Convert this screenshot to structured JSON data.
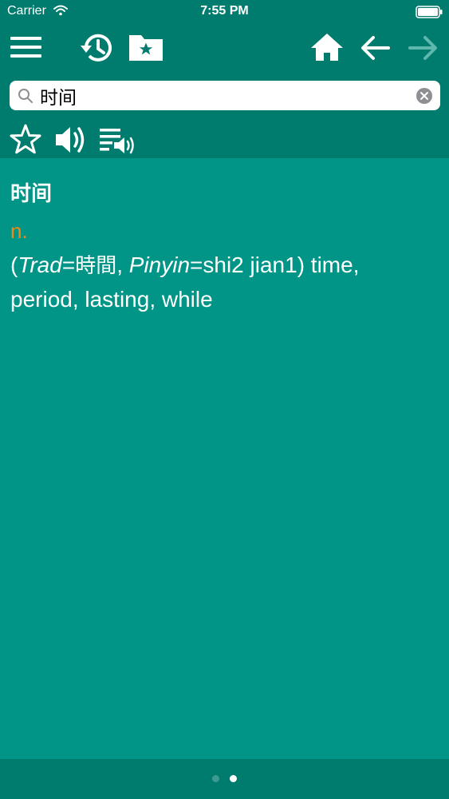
{
  "status_bar": {
    "carrier": "Carrier",
    "time": "7:55 PM"
  },
  "toolbar": {
    "icons": [
      "menu-icon",
      "history-icon",
      "favorites-folder-icon",
      "home-icon",
      "back-arrow-icon",
      "forward-arrow-icon"
    ]
  },
  "search": {
    "value": "时间",
    "placeholder": ""
  },
  "actions": {
    "icons": [
      "star-icon",
      "speaker-icon",
      "speak-list-icon"
    ]
  },
  "entry": {
    "headword": "时间",
    "pos": "n.",
    "def_open": "(",
    "trad_label": "Trad",
    "trad_eq": "=",
    "trad_value": "時間",
    "sep": ", ",
    "pinyin_label": "Pinyin",
    "pinyin_eq": "=",
    "pinyin_value": "shi2 jian1",
    "def_rest": ") time, period, lasting, while"
  },
  "pager": {
    "page_count": 2,
    "current_page": 2
  },
  "colors": {
    "background": "#009587",
    "bar": "#007c6e",
    "accent_orange": "#ef8b14",
    "text": "#ffffff",
    "disabled_arrow": "#5fb7ad"
  }
}
